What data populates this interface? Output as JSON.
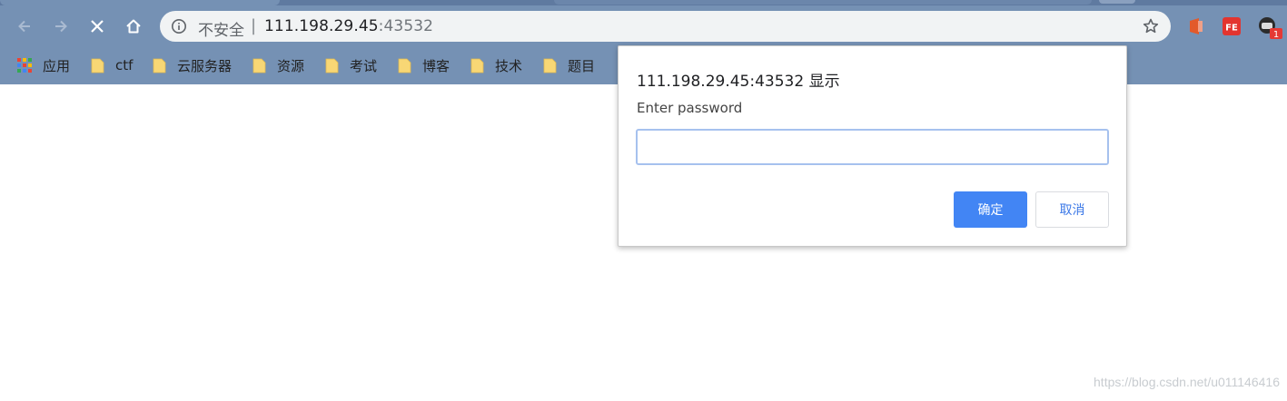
{
  "browser": {
    "omnibox": {
      "security_label": "不安全",
      "separator": "|",
      "host": "111.198.29.45",
      "port": ":43532"
    },
    "icons": {
      "back": "arrow-left-icon",
      "forward": "arrow-right-icon",
      "stop": "close-icon",
      "home": "home-icon",
      "info": "info-icon",
      "bookmark_star": "star-icon"
    },
    "extensions": [
      {
        "name": "office-extension-icon"
      },
      {
        "name": "fe-extension-icon",
        "label": "FE"
      },
      {
        "name": "extension-with-badge-icon",
        "badge": "1"
      }
    ]
  },
  "bookmarks": [
    {
      "label": "应用",
      "type": "apps"
    },
    {
      "label": "ctf",
      "type": "folder"
    },
    {
      "label": "云服务器",
      "type": "folder"
    },
    {
      "label": "资源",
      "type": "folder"
    },
    {
      "label": "考试",
      "type": "folder"
    },
    {
      "label": "博客",
      "type": "folder"
    },
    {
      "label": "技术",
      "type": "folder"
    },
    {
      "label": "题目",
      "type": "folder"
    }
  ],
  "dialog": {
    "title": "111.198.29.45:43532 显示",
    "message": "Enter password",
    "input_value": "",
    "ok_label": "确定",
    "cancel_label": "取消"
  },
  "watermark": "https://blog.csdn.net/u011146416",
  "colors": {
    "chrome_frame": "#7591b4",
    "omnibox_bg": "#f1f3f4",
    "primary_button": "#4285f4",
    "cancel_text": "#3b78e7",
    "folder": "#f8d775"
  }
}
